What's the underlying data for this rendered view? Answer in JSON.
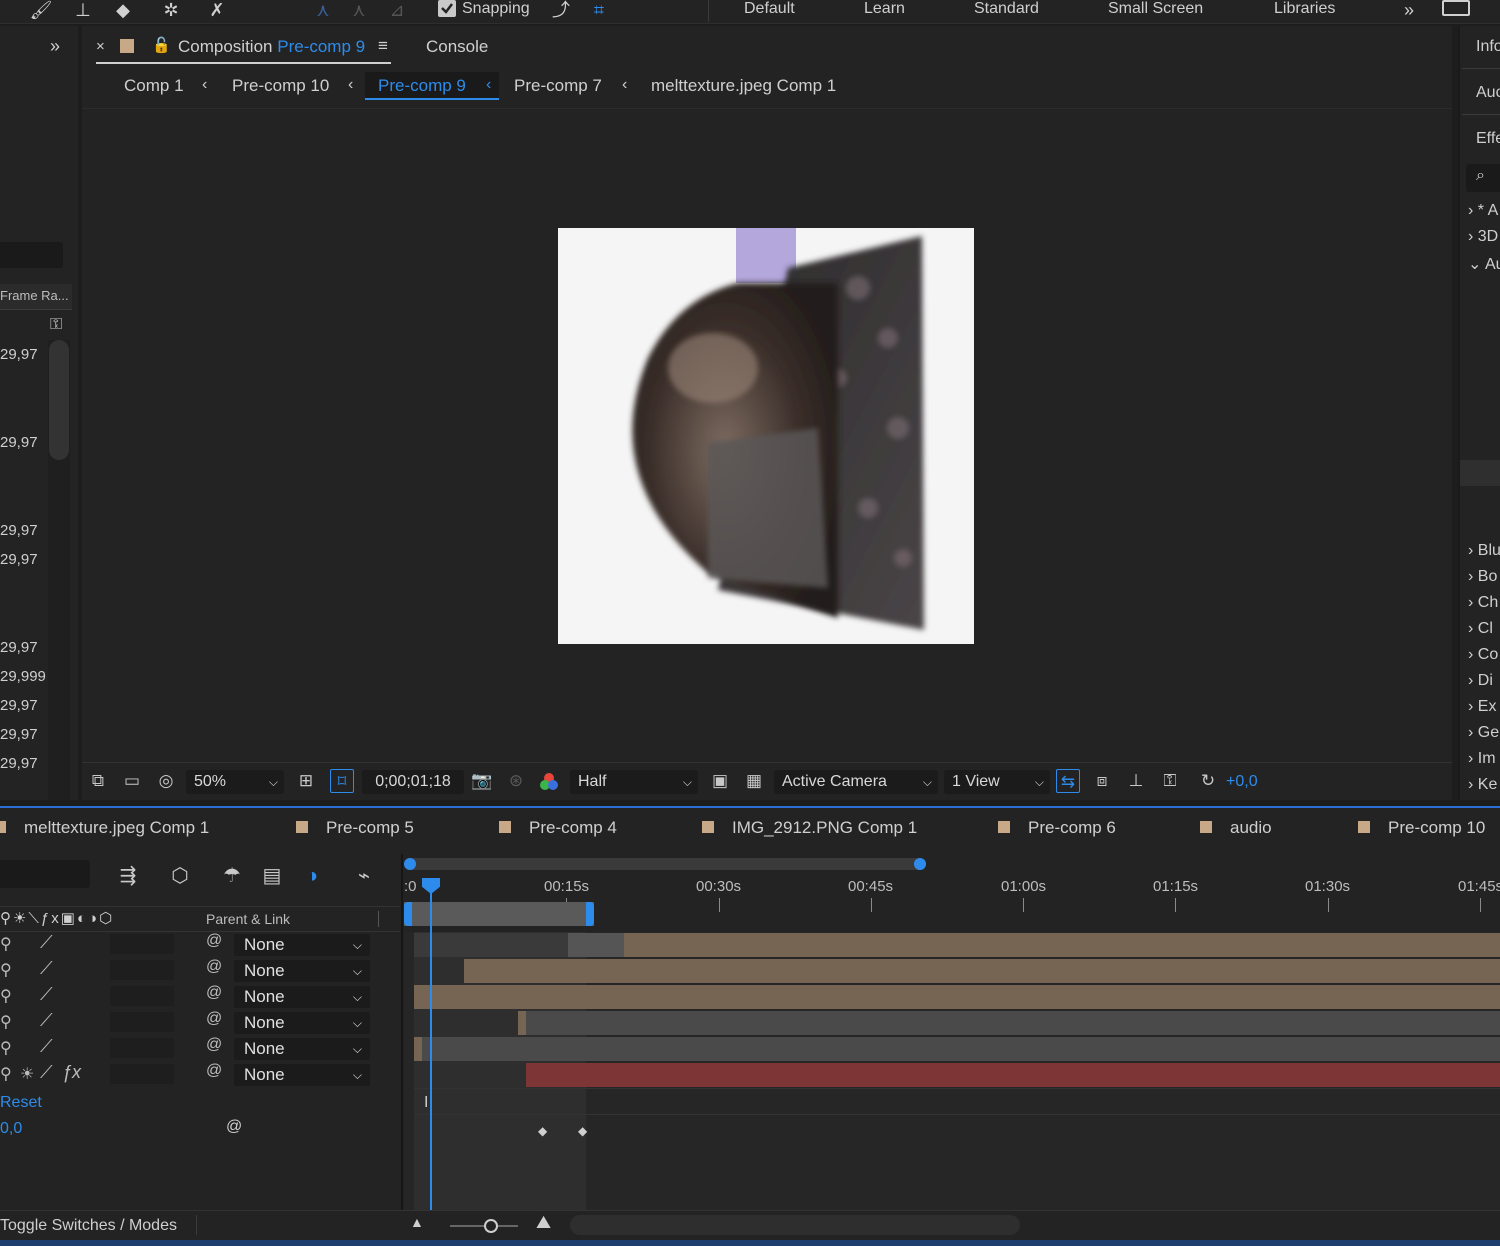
{
  "toolbar": {
    "snapping_label": "Snapping",
    "workspaces": [
      "Default",
      "Learn",
      "Standard",
      "Small Screen",
      "Libraries"
    ]
  },
  "project_panel": {
    "frame_rate_header": "Frame Ra...",
    "frame_rates": [
      "29,97",
      "29,97",
      "29,97",
      "29,97",
      "29,97",
      "29,999",
      "29,97",
      "29,97",
      "29,97"
    ]
  },
  "comp_panel": {
    "title_prefix": "Composition",
    "title_name": "Pre-comp 9",
    "console_tab": "Console",
    "breadcrumbs": [
      "Comp 1",
      "Pre-comp 10",
      "Pre-comp 9",
      "Pre-comp 7",
      "melttexture.jpeg Comp 1"
    ]
  },
  "viewer_bar": {
    "zoom": "50%",
    "timecode": "0;00;01;18",
    "resolution": "Half",
    "camera": "Active Camera",
    "views": "1 View",
    "exposure": "+0,0"
  },
  "right_panel": {
    "items": [
      "Info",
      "Auc",
      "Effe",
      "* A",
      "3D",
      "Au",
      "Blu",
      "Bo",
      "Ch",
      "Cl",
      "Co",
      "Di",
      "Ex",
      "Ge",
      "Im",
      "Ke"
    ]
  },
  "timeline": {
    "tabs": [
      "melttexture.jpeg Comp 1",
      "Pre-comp 5",
      "Pre-comp 4",
      "IMG_2912.PNG Comp 1",
      "Pre-comp 6",
      "audio",
      "Pre-comp 10"
    ],
    "parent_link_header": "Parent & Link",
    "ruler_labels": [
      ":0",
      "00:15s",
      "00:30s",
      "00:45s",
      "01:00s",
      "01:15s",
      "01:30s",
      "01:45s"
    ],
    "parent_values": [
      "None",
      "None",
      "None",
      "None",
      "None",
      "None"
    ],
    "reset_label": "Reset",
    "value_label": "0,0",
    "toggle_label": "Toggle Switches / Modes"
  },
  "colors": {
    "accent": "#2d8ceb",
    "layer_tan": "#756552",
    "layer_grey": "#4a4a4a",
    "layer_red": "#7d3535"
  }
}
